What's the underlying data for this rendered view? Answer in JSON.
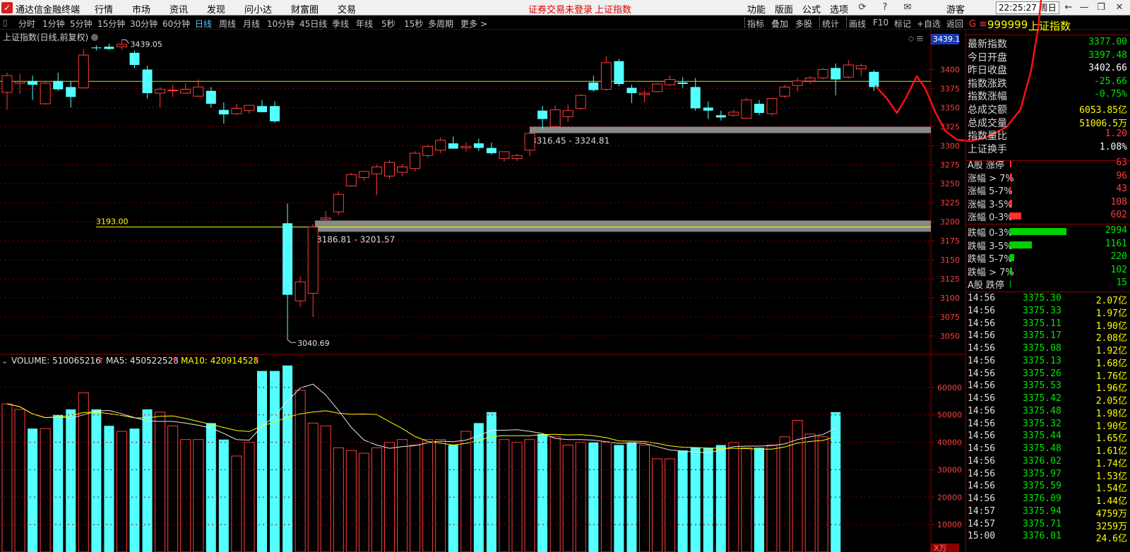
{
  "titlebar": {
    "app_name": "通达信金融终端",
    "menu": [
      "行情",
      "市场",
      "资讯",
      "发现",
      "问小达",
      "财富圈",
      "交易"
    ],
    "notice": "证券交易未登录",
    "index_name": "上证指数",
    "right_menu": [
      "功能",
      "版面",
      "公式",
      "选项"
    ],
    "user": "游客",
    "clock": "22:25:27 周日"
  },
  "toolbar": {
    "periods": [
      "分时",
      "1分钟",
      "5分钟",
      "15分钟",
      "30分钟",
      "60分钟",
      "日线",
      "周线",
      "月线",
      "10分钟",
      "45日线",
      "季线",
      "年线",
      "5秒",
      "15秒",
      "多周期",
      "更多 >"
    ],
    "active_period": "日线",
    "right_tools": [
      "指标",
      "叠加",
      "多股",
      "统计",
      "画线",
      "F10",
      "标记",
      "+自选",
      "返回"
    ]
  },
  "chart_meta": {
    "title": "上证指数(日线,前复权)",
    "top_value_label": "3439.1"
  },
  "chart_data": {
    "type": "candlestick",
    "y_axis_labels": [
      "3400",
      "3375",
      "3350",
      "3325",
      "3300",
      "3275",
      "3250",
      "3225",
      "3200",
      "3175",
      "3150",
      "3125",
      "3100",
      "3075",
      "3050"
    ],
    "ylim": [
      3035,
      3445
    ],
    "high_label": "3439.05",
    "low_label": "3040.69",
    "horizontal_line_label": "3193.00",
    "zone_labels": [
      "3316.45 - 3324.81",
      "3186.81 - 3201.57"
    ],
    "zones": [
      {
        "low": 3316.45,
        "high": 3324.81
      },
      {
        "low": 3186.81,
        "high": 3201.57
      }
    ],
    "reference_lines": [
      3193.0,
      3384.5
    ],
    "candles": [
      {
        "o": 3370,
        "h": 3396,
        "l": 3347,
        "c": 3392
      },
      {
        "o": 3382,
        "h": 3394,
        "l": 3368,
        "c": 3384
      },
      {
        "o": 3385,
        "h": 3392,
        "l": 3360,
        "c": 3380
      },
      {
        "o": 3355,
        "h": 3385,
        "l": 3354,
        "c": 3382
      },
      {
        "o": 3385,
        "h": 3396,
        "l": 3372,
        "c": 3374
      },
      {
        "o": 3377,
        "h": 3385,
        "l": 3350,
        "c": 3364
      },
      {
        "o": 3376,
        "h": 3427,
        "l": 3375,
        "c": 3419
      },
      {
        "o": 3429,
        "h": 3432,
        "l": 3425,
        "c": 3428
      },
      {
        "o": 3430,
        "h": 3434,
        "l": 3426,
        "c": 3427
      },
      {
        "o": 3430,
        "h": 3439.05,
        "l": 3426,
        "c": 3433
      },
      {
        "o": 3422,
        "h": 3425,
        "l": 3402,
        "c": 3406
      },
      {
        "o": 3400,
        "h": 3405,
        "l": 3362,
        "c": 3369
      },
      {
        "o": 3369,
        "h": 3377,
        "l": 3350,
        "c": 3374
      },
      {
        "o": 3373,
        "h": 3380,
        "l": 3364,
        "c": 3373
      },
      {
        "o": 3369,
        "h": 3382,
        "l": 3368,
        "c": 3374
      },
      {
        "o": 3365,
        "h": 3387,
        "l": 3364,
        "c": 3377
      },
      {
        "o": 3372,
        "h": 3377,
        "l": 3350,
        "c": 3355
      },
      {
        "o": 3347,
        "h": 3357,
        "l": 3329,
        "c": 3341
      },
      {
        "o": 3342,
        "h": 3355,
        "l": 3340,
        "c": 3349
      },
      {
        "o": 3346,
        "h": 3352,
        "l": 3342,
        "c": 3353
      },
      {
        "o": 3352,
        "h": 3360,
        "l": 3344,
        "c": 3344
      },
      {
        "o": 3352,
        "h": 3358,
        "l": 3330,
        "c": 3332
      },
      {
        "o": 3198,
        "h": 3224,
        "l": 3045,
        "c": 3104
      },
      {
        "o": 3096,
        "h": 3128,
        "l": 3088,
        "c": 3121
      },
      {
        "o": 3106,
        "h": 3197,
        "l": 3075,
        "c": 3193
      },
      {
        "o": 3203,
        "h": 3214,
        "l": 3200,
        "c": 3205
      },
      {
        "o": 3213,
        "h": 3240,
        "l": 3209,
        "c": 3236
      },
      {
        "o": 3247,
        "h": 3264,
        "l": 3246,
        "c": 3262
      },
      {
        "o": 3258,
        "h": 3267,
        "l": 3254,
        "c": 3266
      },
      {
        "o": 3263,
        "h": 3275,
        "l": 3235,
        "c": 3272
      },
      {
        "o": 3260,
        "h": 3281,
        "l": 3256,
        "c": 3278
      },
      {
        "o": 3265,
        "h": 3276,
        "l": 3260,
        "c": 3272
      },
      {
        "o": 3270,
        "h": 3293,
        "l": 3266,
        "c": 3290
      },
      {
        "o": 3287,
        "h": 3301,
        "l": 3284,
        "c": 3299
      },
      {
        "o": 3294,
        "h": 3311,
        "l": 3290,
        "c": 3307
      },
      {
        "o": 3303,
        "h": 3312,
        "l": 3296,
        "c": 3296
      },
      {
        "o": 3297,
        "h": 3304,
        "l": 3292,
        "c": 3299
      },
      {
        "o": 3303,
        "h": 3309,
        "l": 3293,
        "c": 3297
      },
      {
        "o": 3297,
        "h": 3304,
        "l": 3288,
        "c": 3290
      },
      {
        "o": 3283,
        "h": 3292,
        "l": 3279,
        "c": 3292
      },
      {
        "o": 3283,
        "h": 3289,
        "l": 3280,
        "c": 3287
      },
      {
        "o": 3294,
        "h": 3320,
        "l": 3286,
        "c": 3316
      },
      {
        "o": 3346,
        "h": 3352,
        "l": 3322,
        "c": 3335
      },
      {
        "o": 3325,
        "h": 3353,
        "l": 3323,
        "c": 3347
      },
      {
        "o": 3338,
        "h": 3354,
        "l": 3331,
        "c": 3346
      },
      {
        "o": 3349,
        "h": 3368,
        "l": 3347,
        "c": 3366
      },
      {
        "o": 3383,
        "h": 3392,
        "l": 3371,
        "c": 3373
      },
      {
        "o": 3374,
        "h": 3418,
        "l": 3372,
        "c": 3409
      },
      {
        "o": 3411,
        "h": 3414,
        "l": 3378,
        "c": 3381
      },
      {
        "o": 3376,
        "h": 3380,
        "l": 3356,
        "c": 3369
      },
      {
        "o": 3367,
        "h": 3373,
        "l": 3357,
        "c": 3369
      },
      {
        "o": 3371,
        "h": 3382,
        "l": 3370,
        "c": 3381
      },
      {
        "o": 3380,
        "h": 3392,
        "l": 3378,
        "c": 3387
      },
      {
        "o": 3383,
        "h": 3390,
        "l": 3376,
        "c": 3381
      },
      {
        "o": 3377,
        "h": 3389,
        "l": 3346,
        "c": 3349
      },
      {
        "o": 3350,
        "h": 3358,
        "l": 3335,
        "c": 3346
      },
      {
        "o": 3340,
        "h": 3346,
        "l": 3333,
        "c": 3337
      },
      {
        "o": 3340,
        "h": 3347,
        "l": 3338,
        "c": 3344
      },
      {
        "o": 3336,
        "h": 3363,
        "l": 3336,
        "c": 3360
      },
      {
        "o": 3355,
        "h": 3360,
        "l": 3340,
        "c": 3343
      },
      {
        "o": 3342,
        "h": 3362,
        "l": 3339,
        "c": 3362
      },
      {
        "o": 3365,
        "h": 3380,
        "l": 3363,
        "c": 3377
      },
      {
        "o": 3379,
        "h": 3389,
        "l": 3371,
        "c": 3385
      },
      {
        "o": 3385,
        "h": 3391,
        "l": 3381,
        "c": 3389
      },
      {
        "o": 3389,
        "h": 3402,
        "l": 3387,
        "c": 3400
      },
      {
        "o": 3402,
        "h": 3408,
        "l": 3366,
        "c": 3387
      },
      {
        "o": 3390,
        "h": 3412,
        "l": 3388,
        "c": 3406
      },
      {
        "o": 3401,
        "h": 3408,
        "l": 3392,
        "c": 3405
      },
      {
        "o": 3397,
        "h": 3399,
        "l": 3372,
        "c": 3377
      }
    ],
    "volume": {
      "label": "VOLUME: 510065216",
      "ma5_label": "MA5: 450522528",
      "ma10_label": "MA10: 420914528",
      "y_axis_labels": [
        "60000",
        "50000",
        "40000",
        "30000",
        "20000",
        "10000"
      ],
      "unit_label": "X万",
      "ylim": [
        0,
        70000
      ],
      "values": [
        54000,
        52000,
        45000,
        45000,
        50000,
        52000,
        58000,
        52000,
        46000,
        44000,
        45000,
        52000,
        51000,
        46000,
        41000,
        41000,
        47000,
        41000,
        35000,
        40000,
        66000,
        66000,
        68000,
        59000,
        47000,
        46000,
        38000,
        37000,
        36000,
        38000,
        40000,
        41000,
        39000,
        41000,
        41000,
        39000,
        44000,
        47000,
        51000,
        41000,
        40000,
        41000,
        43000,
        42000,
        39000,
        40000,
        40000,
        40000,
        39000,
        40000,
        39000,
        34000,
        34000,
        37000,
        38000,
        38000,
        39000,
        40000,
        38000,
        38000,
        39000,
        42000,
        48000,
        43000,
        42000,
        51000
      ]
    }
  },
  "quote_panel": {
    "header_code": "999999",
    "header_name": "上证指数",
    "rows": [
      {
        "label": "最新指数",
        "value": "3377.00",
        "color": "green"
      },
      {
        "label": "今日开盘",
        "value": "3397.48",
        "color": "green"
      },
      {
        "label": "昨日收盘",
        "value": "3402.66",
        "color": "white"
      },
      {
        "label": "指数涨跌",
        "value": "-25.66",
        "color": "green"
      },
      {
        "label": "指数涨幅",
        "value": "-0.75%",
        "color": "green"
      },
      {
        "label": "总成交额",
        "value": "6053.85亿",
        "color": "yellow"
      },
      {
        "label": "总成交量",
        "value": "51006.5万",
        "color": "yellow"
      },
      {
        "label": "指数量比",
        "value": "1.20",
        "color": "red"
      },
      {
        "label": "上证换手",
        "value": "1.08%",
        "color": "white"
      }
    ],
    "breadth": [
      {
        "label": "A股 涨停",
        "value": "63",
        "bar": 63,
        "color": "red"
      },
      {
        "label": "涨幅 > 7%",
        "value": "96",
        "bar": 96,
        "color": "red"
      },
      {
        "label": "涨幅 5-7%",
        "value": "43",
        "bar": 43,
        "color": "red"
      },
      {
        "label": "涨幅 3-5%",
        "value": "108",
        "bar": 108,
        "color": "red"
      },
      {
        "label": "涨幅 0-3%",
        "value": "602",
        "bar": 602,
        "color": "red"
      },
      {
        "label": "跌幅 0-3%",
        "value": "2994",
        "bar": 2994,
        "color": "green"
      },
      {
        "label": "跌幅 3-5%",
        "value": "1161",
        "bar": 1161,
        "color": "green"
      },
      {
        "label": "跌幅 5-7%",
        "value": "220",
        "bar": 220,
        "color": "green"
      },
      {
        "label": "跌幅 > 7%",
        "value": "102",
        "bar": 102,
        "color": "green"
      },
      {
        "label": "A股 跌停",
        "value": "15",
        "bar": 15,
        "color": "green"
      }
    ],
    "ticks": [
      {
        "time": "14:56",
        "price": "3375.30",
        "amount": "2.07亿"
      },
      {
        "time": "14:56",
        "price": "3375.33",
        "amount": "1.97亿"
      },
      {
        "time": "14:56",
        "price": "3375.11",
        "amount": "1.90亿"
      },
      {
        "time": "14:56",
        "price": "3375.17",
        "amount": "2.08亿"
      },
      {
        "time": "14:56",
        "price": "3375.08",
        "amount": "1.92亿"
      },
      {
        "time": "14:56",
        "price": "3375.13",
        "amount": "1.68亿"
      },
      {
        "time": "14:56",
        "price": "3375.26",
        "amount": "1.76亿"
      },
      {
        "time": "14:56",
        "price": "3375.53",
        "amount": "1.96亿"
      },
      {
        "time": "14:56",
        "price": "3375.42",
        "amount": "2.05亿"
      },
      {
        "time": "14:56",
        "price": "3375.48",
        "amount": "1.98亿"
      },
      {
        "time": "14:56",
        "price": "3375.32",
        "amount": "1.90亿"
      },
      {
        "time": "14:56",
        "price": "3375.44",
        "amount": "1.65亿"
      },
      {
        "time": "14:56",
        "price": "3375.48",
        "amount": "1.61亿"
      },
      {
        "time": "14:56",
        "price": "3376.02",
        "amount": "1.74亿"
      },
      {
        "time": "14:56",
        "price": "3375.97",
        "amount": "1.53亿"
      },
      {
        "time": "14:56",
        "price": "3375.59",
        "amount": "1.54亿"
      },
      {
        "time": "14:56",
        "price": "3376.09",
        "amount": "1.44亿"
      },
      {
        "time": "14:57",
        "price": "3375.94",
        "amount": "4759万"
      },
      {
        "time": "14:57",
        "price": "3375.71",
        "amount": "3259万"
      },
      {
        "time": "15:00",
        "price": "3376.01",
        "amount": "24.6亿"
      }
    ]
  },
  "colors": {
    "up": "#ff3c3c",
    "down": "#54ffff",
    "ma5": "#e8e8e8",
    "ma10": "#ffff00",
    "zone": "#a0a0a0",
    "grid": "#8b0000",
    "hand_drawn": "#ff1010"
  }
}
